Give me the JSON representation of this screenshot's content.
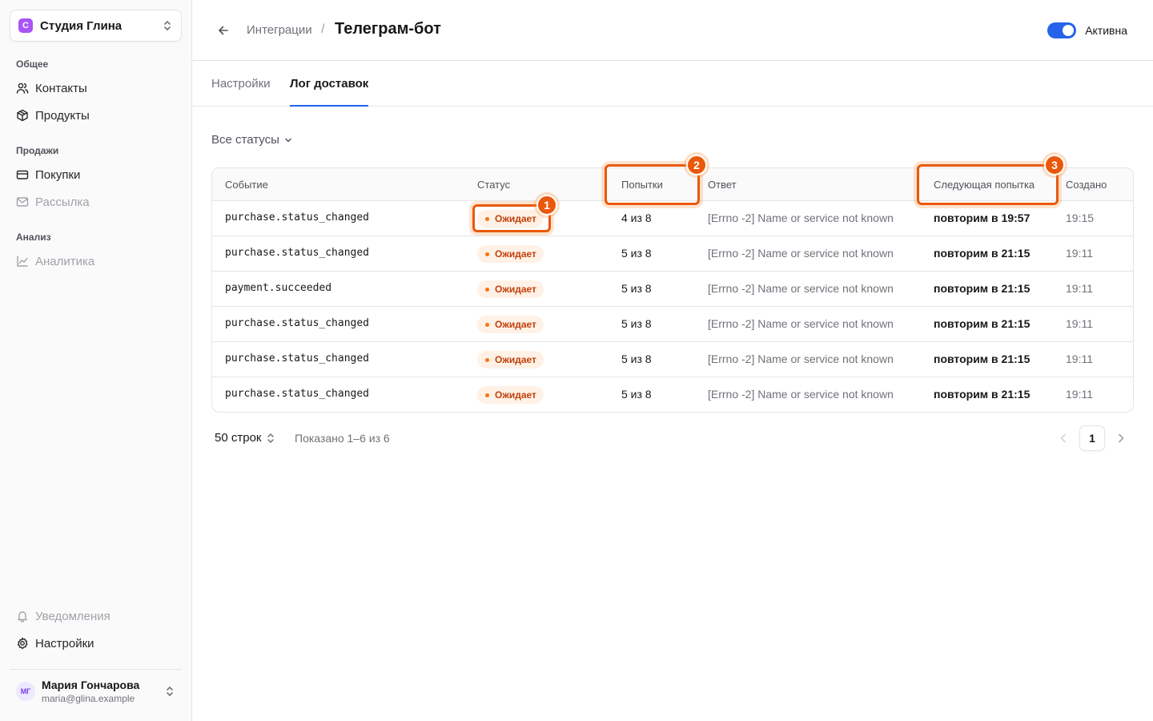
{
  "workspace": {
    "logo": "С",
    "name": "Студия Глина"
  },
  "sidebar": {
    "sections": [
      {
        "label": "Общее",
        "items": [
          {
            "label": "Контакты",
            "icon": "users-icon"
          },
          {
            "label": "Продукты",
            "icon": "box-icon"
          }
        ]
      },
      {
        "label": "Продажи",
        "items": [
          {
            "label": "Покупки",
            "icon": "card-icon"
          },
          {
            "label": "Рассылка",
            "icon": "mail-icon"
          }
        ]
      },
      {
        "label": "Анализ",
        "items": [
          {
            "label": "Аналитика",
            "icon": "chart-icon"
          }
        ]
      }
    ],
    "bottom": [
      {
        "label": "Уведомления",
        "icon": "bell-icon"
      },
      {
        "label": "Настройки",
        "icon": "gear-icon"
      }
    ],
    "user": {
      "initials": "МГ",
      "name": "Мария Гончарова",
      "email": "maria@glina.example"
    }
  },
  "header": {
    "breadcrumb": "Интеграции",
    "separator": "/",
    "title": "Телеграм-бот",
    "toggle_label": "Активна",
    "toggle_on": true
  },
  "tabs": [
    {
      "label": "Настройки",
      "active": false
    },
    {
      "label": "Лог доставок",
      "active": true
    }
  ],
  "filter": {
    "label": "Все статусы"
  },
  "table": {
    "columns": [
      "Событие",
      "Статус",
      "Попытки",
      "Ответ",
      "Следующая попытка",
      "Создано"
    ],
    "rows": [
      {
        "event": "purchase.status_changed",
        "status": "Ожидает",
        "attempts": "4 из 8",
        "response": "[Errno -2] Name or service not known",
        "next": "повторим в 19:57",
        "created": "19:15"
      },
      {
        "event": "purchase.status_changed",
        "status": "Ожидает",
        "attempts": "5 из 8",
        "response": "[Errno -2] Name or service not known",
        "next": "повторим в 21:15",
        "created": "19:11"
      },
      {
        "event": "payment.succeeded",
        "status": "Ожидает",
        "attempts": "5 из 8",
        "response": "[Errno -2] Name or service not known",
        "next": "повторим в 21:15",
        "created": "19:11"
      },
      {
        "event": "purchase.status_changed",
        "status": "Ожидает",
        "attempts": "5 из 8",
        "response": "[Errno -2] Name or service not known",
        "next": "повторим в 21:15",
        "created": "19:11"
      },
      {
        "event": "purchase.status_changed",
        "status": "Ожидает",
        "attempts": "5 из 8",
        "response": "[Errno -2] Name or service not known",
        "next": "повторим в 21:15",
        "created": "19:11"
      },
      {
        "event": "purchase.status_changed",
        "status": "Ожидает",
        "attempts": "5 из 8",
        "response": "[Errno -2] Name or service not known",
        "next": "повторим в 21:15",
        "created": "19:11"
      }
    ]
  },
  "pager": {
    "rows_label": "50 строк",
    "shown": "Показано 1–6 из 6",
    "page": "1"
  },
  "markers": [
    "1",
    "2",
    "3"
  ],
  "colors": {
    "accent": "#2563eb",
    "highlight": "#ea580c",
    "badge_bg": "#fff1e6",
    "badge_text": "#c2410c"
  }
}
